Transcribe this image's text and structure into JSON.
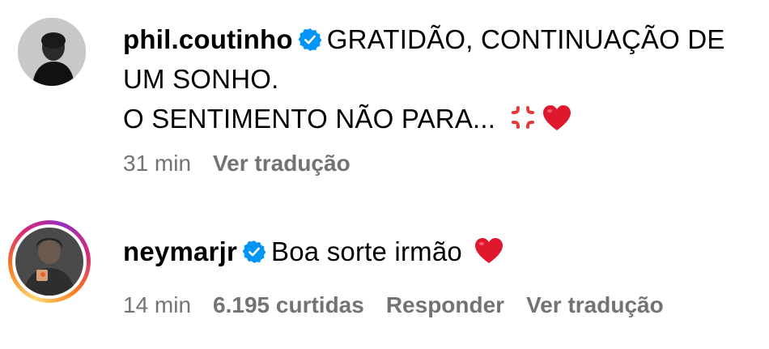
{
  "comments": [
    {
      "username": "phil.coutinho",
      "text": "GRATIDÃO, CONTINUAÇÃO DE UM SONHO.",
      "text_line2": "O SENTIMENTO NÃO PARA...",
      "emojis": [
        "anger-symbol-icon",
        "red-heart-icon"
      ],
      "time": "31 min",
      "translate_label": "Ver tradução",
      "verified": true
    },
    {
      "username": "neymarjr",
      "text": "Boa sorte irmão",
      "emojis": [
        "red-heart-icon"
      ],
      "time": "14 min",
      "likes_label": "6.195 curtidas",
      "reply_label": "Responder",
      "translate_label": "Ver tradução",
      "verified": true,
      "has_story_ring": true
    }
  ],
  "colors": {
    "verified_blue": "#0095f6",
    "meta_gray": "#737373",
    "heart_red": "#e0182d",
    "anger_red": "#e53935"
  }
}
